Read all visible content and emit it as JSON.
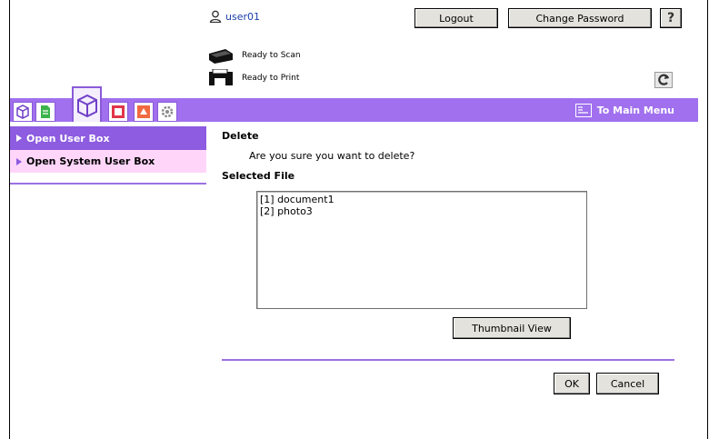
{
  "header": {
    "username": "user01",
    "logout_label": "Logout",
    "change_password_label": "Change Password",
    "help_label": "?"
  },
  "status": {
    "scanner": "Ready to Scan",
    "printer": "Ready to Print"
  },
  "nav": {
    "main_menu_label": "To Main Menu",
    "tabs": [
      "fax-tab-icon",
      "document-tab-icon",
      "box-tab-icon",
      "print-tab-icon",
      "store-tab-icon",
      "settings-tab-icon"
    ],
    "accent_color": "#a070ee"
  },
  "sidebar": {
    "items": [
      {
        "label": "Open User Box",
        "selected": true
      },
      {
        "label": "Open System User Box",
        "selected": false
      }
    ]
  },
  "main": {
    "delete_heading": "Delete",
    "confirm_message": "Are you sure you want to delete?",
    "selected_heading": "Selected File",
    "files": [
      "[1] document1",
      "[2] photo3"
    ],
    "thumbnail_label": "Thumbnail View",
    "ok_label": "OK",
    "cancel_label": "Cancel"
  }
}
